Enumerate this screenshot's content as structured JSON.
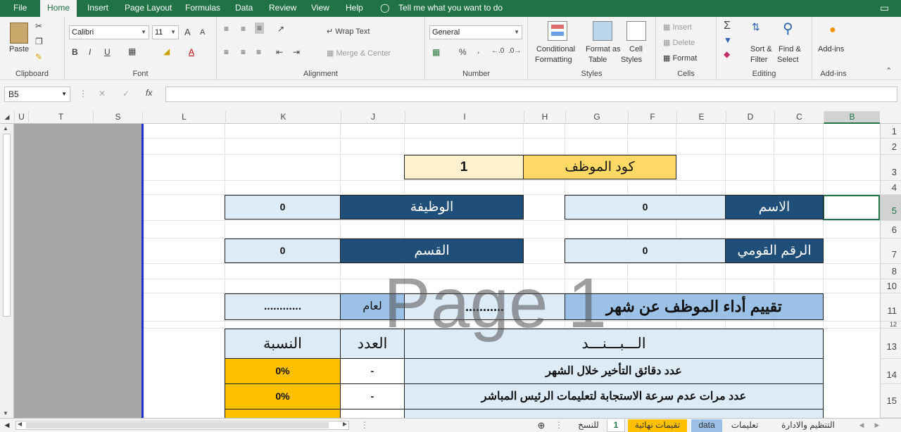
{
  "menu": {
    "file": "File",
    "home": "Home",
    "insert": "Insert",
    "page_layout": "Page Layout",
    "formulas": "Formulas",
    "data": "Data",
    "review": "Review",
    "view": "View",
    "help": "Help",
    "tell_me": "Tell me what you want to do"
  },
  "ribbon": {
    "clipboard": {
      "label": "Clipboard",
      "paste": "Paste"
    },
    "font": {
      "label": "Font",
      "name": "Calibri",
      "size": "11",
      "bold": "B",
      "italic": "I",
      "underline": "U",
      "grow": "A",
      "shrink": "A",
      "color": "A"
    },
    "alignment": {
      "label": "Alignment",
      "wrap_text": "Wrap Text",
      "merge_center": "Merge & Center"
    },
    "number": {
      "label": "Number",
      "format": "General",
      "percent": "%",
      "comma": ","
    },
    "styles": {
      "label": "Styles",
      "conditional_1": "Conditional",
      "conditional_2": "Formatting",
      "format_table_1": "Format as",
      "format_table_2": "Table",
      "cell_styles_1": "Cell",
      "cell_styles_2": "Styles"
    },
    "cells": {
      "label": "Cells",
      "insert": "Insert",
      "delete": "Delete",
      "format": "Format"
    },
    "editing": {
      "label": "Editing",
      "sort_1": "Sort &",
      "sort_2": "Filter",
      "find_1": "Find &",
      "find_2": "Select"
    },
    "addins": {
      "label": "Add-ins",
      "button": "Add-ins"
    }
  },
  "formula_bar": {
    "name_box": "B5",
    "fx": "fx",
    "cancel": "✕",
    "enter": "✓",
    "value": ""
  },
  "columns": [
    "U",
    "T",
    "S",
    "L",
    "K",
    "J",
    "I",
    "H",
    "G",
    "F",
    "E",
    "D",
    "C",
    "B"
  ],
  "rows": [
    "1",
    "2",
    "3",
    "4",
    "5",
    "6",
    "7",
    "8",
    "10",
    "11",
    "12",
    "13",
    "14",
    "15"
  ],
  "watermark": "Page 1",
  "form": {
    "employee_code_label": "كود الموظف",
    "employee_code_value": "1",
    "name_label": "الاسم",
    "name_value": "0",
    "job_label": "الوظيفة",
    "job_value": "0",
    "national_id_label": "الرقم القومي",
    "national_id_value": "0",
    "department_label": "القسم",
    "department_value": "0",
    "eval_title": "تقييم أداء الموظف عن شهر",
    "month_value": "...........",
    "year_label": "لعام",
    "year_value": "............"
  },
  "table": {
    "headers": {
      "item": "الـــبـــنـــد",
      "count": "العدد",
      "percent": "النسبة"
    },
    "rows": [
      {
        "item": "عدد دقائق التأخير خلال الشهر",
        "count": "-",
        "percent": "0%"
      },
      {
        "item": "عدد مرات عدم سرعة الاستجابة لتعليمات الرئيس المباشر",
        "count": "-",
        "percent": "0%"
      }
    ]
  },
  "sheet_tabs": {
    "t1": "التنظيم والادارة",
    "t2": "تعليمات",
    "t3": "data",
    "t4": "تقيمات نهائية",
    "t5": "1",
    "t6": "للنسخ"
  },
  "colors": {
    "excel_green": "#217346",
    "header_blue": "#1f4e79",
    "light_blue": "#ddebf7",
    "mid_blue": "#9bc2e6",
    "code_yellow": "#ffd966",
    "light_yellow": "#fff2cc",
    "percent_orange": "#ffc000",
    "sheet_tab_yellow": "#ffc000",
    "sheet_tab_blue": "#9bc2e6"
  }
}
